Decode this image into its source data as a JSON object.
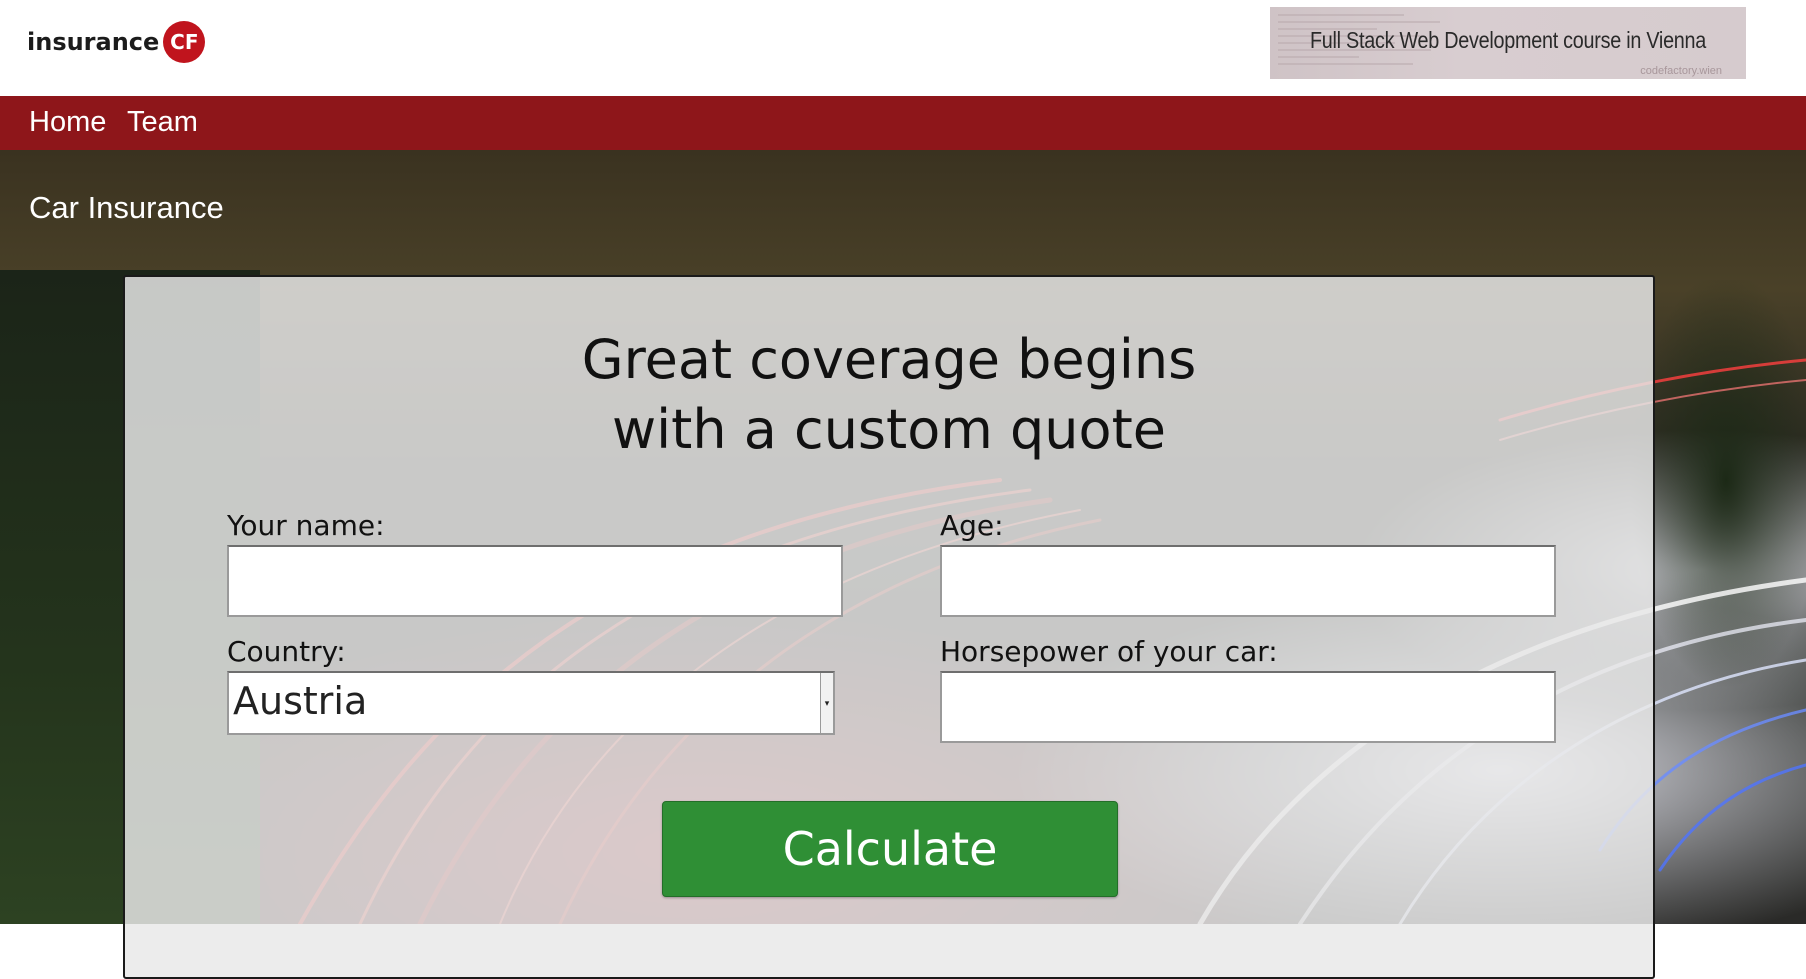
{
  "header": {
    "logo_text": "insurance",
    "logo_badge": "CF",
    "ad_text": "Full Stack Web Development course in Vienna",
    "ad_subtext": "codefactory.wien"
  },
  "nav": {
    "items": [
      {
        "label": "Home"
      },
      {
        "label": "Team"
      }
    ]
  },
  "page": {
    "heading": "Car Insurance"
  },
  "form": {
    "title_line1": "Great coverage begins",
    "title_line2": "with a custom quote",
    "name_label": "Your name:",
    "name_value": "",
    "age_label": "Age:",
    "age_value": "",
    "country_label": "Country:",
    "country_selected": "Austria",
    "horsepower_label": "Horsepower of your car:",
    "horsepower_value": "",
    "submit_label": "Calculate"
  },
  "colors": {
    "brand_red": "#8e161a",
    "logo_red": "#c0141d",
    "button_green": "#2f8f35"
  }
}
